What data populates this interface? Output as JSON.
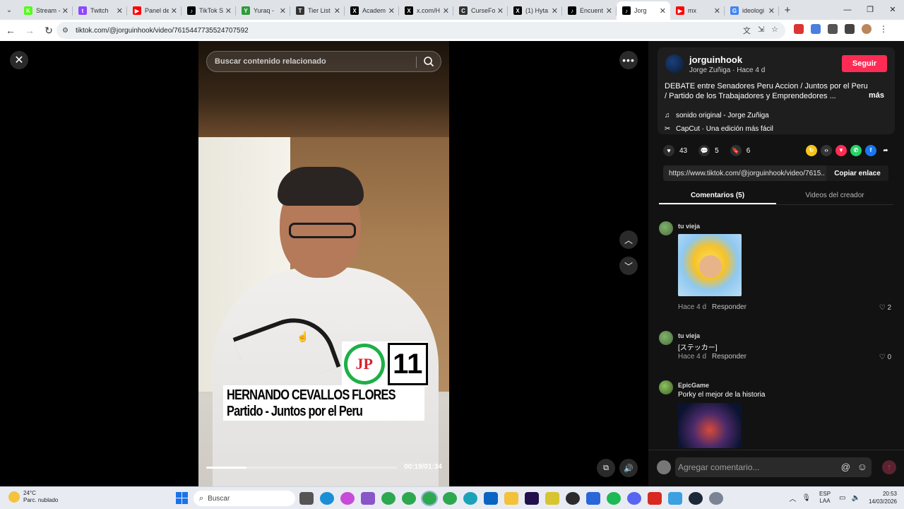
{
  "browser": {
    "tabs": [
      {
        "label": "Stream -",
        "color": "#53fc18",
        "glyph": "K"
      },
      {
        "label": "Twitch",
        "color": "#9146ff",
        "glyph": "t"
      },
      {
        "label": "Panel de",
        "color": "#ff0000",
        "glyph": "▶"
      },
      {
        "label": "TikTok S",
        "color": "#000000",
        "glyph": "♪"
      },
      {
        "label": "Yuraq -",
        "color": "#2e9b3b",
        "glyph": "Y"
      },
      {
        "label": "Tier List",
        "color": "#333333",
        "glyph": "T"
      },
      {
        "label": "Academ",
        "color": "#000000",
        "glyph": "X"
      },
      {
        "label": "x.com/H",
        "color": "#000000",
        "glyph": "X"
      },
      {
        "label": "CurseFo",
        "color": "#333333",
        "glyph": "C"
      },
      {
        "label": "(1) Hyta",
        "color": "#000000",
        "glyph": "X"
      },
      {
        "label": "Encuent",
        "color": "#000000",
        "glyph": "♪"
      },
      {
        "label": "Jorg",
        "color": "#000000",
        "glyph": "♪"
      },
      {
        "label": "mx",
        "color": "#ff0000",
        "glyph": "▶"
      },
      {
        "label": "ideologi",
        "color": "#4285f4",
        "glyph": "G"
      }
    ],
    "active_tab_index": 11,
    "url": "tiktok.com/@jorguinhook/video/7615447735524707592"
  },
  "player": {
    "search_placeholder": "Buscar contenido relacionado",
    "overlay_number": "11",
    "overlay_logo": "JP",
    "overlay_name": "HERNANDO CEVALLOS FLORES",
    "overlay_party": "Partido - Juntos por el Peru",
    "time": "00:19/01:34",
    "progress_fraction": 0.21
  },
  "panel": {
    "username": "jorguinhook",
    "subtitle": "Jorge Zuñiga · Hace 4 d",
    "follow_label": "Seguir",
    "description": "DEBATE entre Senadores Peru Accion / Juntos por el Peru / Partido de los Trabajadores y Emprendedores  ...",
    "more_label": "más",
    "sound": "sonido original - Jorge Zuñiga",
    "capcut": "CapCut · Una edición más fácil",
    "likes": "43",
    "comments_count": "5",
    "saves": "6",
    "share_link": "https://www.tiktok.com/@jorguinhook/video/7615...",
    "copy_label": "Copiar enlace",
    "tab_comments": "Comentarios (5)",
    "tab_creator": "Videos del creador",
    "comments": [
      {
        "user": "tu vieja",
        "text": "",
        "time": "Hace 4 d",
        "reply": "Responder",
        "likes": "2"
      },
      {
        "user": "tu vieja",
        "text": "[ステッカー]",
        "time": "Hace 4 d",
        "reply": "Responder",
        "likes": "0"
      },
      {
        "user": "EpicGame",
        "text": "Porky el mejor de la historia",
        "time": "",
        "reply": "",
        "likes": ""
      }
    ],
    "comment_placeholder": "Agregar comentario..."
  },
  "taskbar": {
    "temperature": "24°C",
    "weather": "Parc. nublado",
    "search_label": "Buscar",
    "lang_line1": "ESP",
    "lang_line2": "LAA",
    "time": "20:53",
    "date": "14/03/2026"
  }
}
